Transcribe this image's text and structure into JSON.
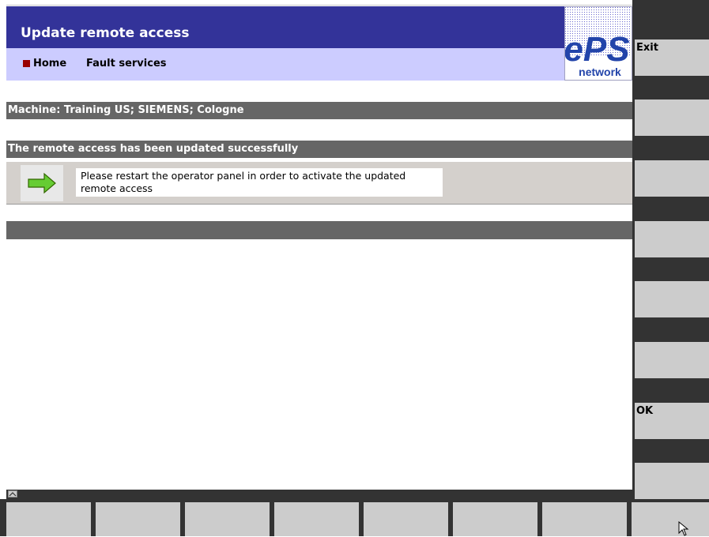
{
  "header": {
    "title": "Update remote access",
    "nav": [
      "Home",
      "Fault services"
    ],
    "logo": {
      "main": "ePS",
      "sub": "network"
    }
  },
  "machine_info": "Machine: Training US; SIEMENS; Cologne",
  "status_message": "The remote access has been updated successfully",
  "instruction": "Please restart the operator panel in order to activate the updated remote access",
  "vertical_softkeys": [
    "Exit",
    "",
    "",
    "",
    "",
    "",
    "OK",
    "",
    ""
  ],
  "horizontal_softkeys": [
    "",
    "",
    "",
    "",
    "",
    "",
    "",
    ""
  ],
  "icons": [
    "arrow-right-icon",
    "scroll-up-icon",
    "mouse-cursor-icon"
  ],
  "colors": {
    "title_bar": "#333399",
    "nav_bar": "#ccccff",
    "band": "#666666",
    "softkey": "#cccccc",
    "softkey_frame": "#333333",
    "arrow": "#66cc33",
    "bullet": "#990000"
  }
}
